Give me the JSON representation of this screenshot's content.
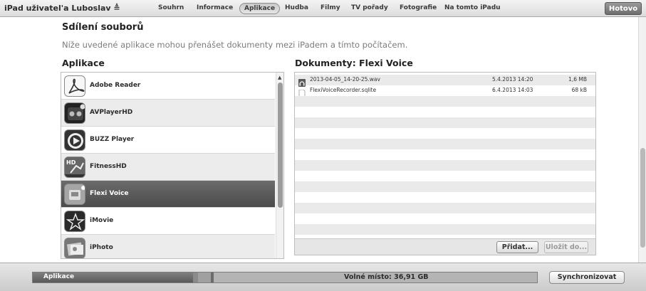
{
  "header": {
    "device_name": "iPad uživatel'a Luboslav ≜",
    "tabs": [
      {
        "label": "Souhrn",
        "active": false
      },
      {
        "label": "Informace",
        "active": false
      },
      {
        "label": "Aplikace",
        "active": true
      },
      {
        "label": "Hudba",
        "active": false
      },
      {
        "label": "Filmy",
        "active": false
      },
      {
        "label": "TV pořady",
        "active": false
      },
      {
        "label": "Fotografie",
        "active": false
      },
      {
        "label": "Na tomto iPadu",
        "active": false
      }
    ],
    "done_label": "Hotovo"
  },
  "file_sharing": {
    "title": "Sdílení souborů",
    "description": "Níže uvedené aplikace mohou přenášet dokumenty mezi iPadem a tímto počítačem.",
    "apps_header": "Aplikace",
    "docs_header": "Dokumenty: Flexi Voice"
  },
  "apps": [
    {
      "name": "Adobe Reader",
      "icon": "adobe-reader-icon",
      "selected": false
    },
    {
      "name": "AVPlayerHD",
      "icon": "avplayerhd-icon",
      "selected": false
    },
    {
      "name": "BUZZ Player",
      "icon": "buzz-player-icon",
      "selected": false
    },
    {
      "name": "FitnessHD",
      "icon": "fitnesshd-icon",
      "selected": false
    },
    {
      "name": "Flexi Voice",
      "icon": "flexi-voice-icon",
      "selected": true
    },
    {
      "name": "iMovie",
      "icon": "imovie-icon",
      "selected": false
    },
    {
      "name": "iPhoto",
      "icon": "iphoto-icon",
      "selected": false
    }
  ],
  "documents": [
    {
      "name": "2013-04-05_14-20-25.wav",
      "date": "5.4.2013 14:20",
      "size": "1,6 MB",
      "icon": "audio-file-icon"
    },
    {
      "name": "FlexiVoiceRecorder.sqlite",
      "date": "6.4.2013 14:03",
      "size": "68 kB",
      "icon": "document-file-icon"
    }
  ],
  "doc_buttons": {
    "add_label": "Přidat...",
    "save_label": "Uložit do..."
  },
  "footer": {
    "capacity_label": "Aplikace",
    "free_space_label": "Volné místo: 36,91 GB",
    "sync_label": "Synchronizovat"
  },
  "colors": {
    "selected_row": "#565656",
    "topbar": "#e2e2e2",
    "done_button": "#7c7c7c"
  }
}
